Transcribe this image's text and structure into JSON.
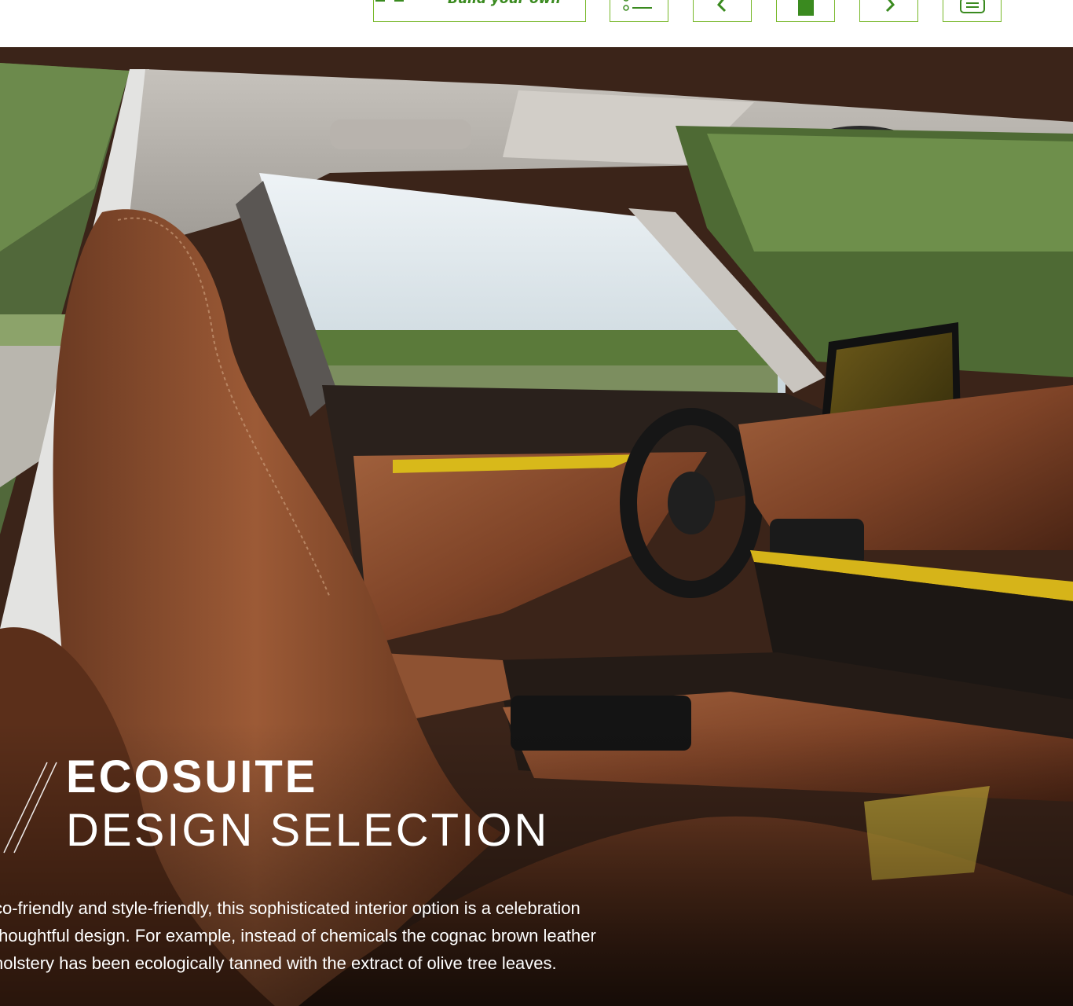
{
  "toolbar": {
    "build_label": "Build your own",
    "build_icon": "car-config-icon",
    "list_icon": "list-icon",
    "prev_icon": "chevron-left-icon",
    "page_icon": "page-icon",
    "next_icon": "chevron-right-icon",
    "print_icon": "print-icon",
    "accent_color": "#78b82a"
  },
  "feature": {
    "title_bold": "ECOSUITE",
    "title_light": "DESIGN SELECTION",
    "body_lines": [
      "co-friendly and style-friendly, this sophisticated interior option is a celebration",
      "thoughtful design. For example, instead of chemicals the cognac brown leather",
      "holstery has been ecologically tanned with the extract of olive tree leaves."
    ]
  }
}
